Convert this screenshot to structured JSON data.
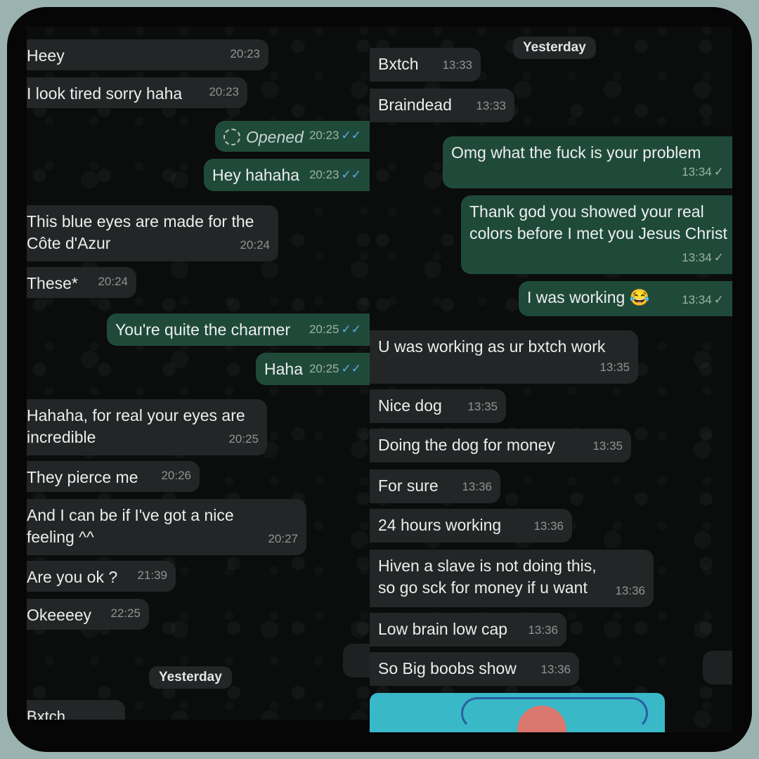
{
  "left": {
    "messages": [
      {
        "text": "Heey",
        "time": "20:23",
        "dir": "in"
      },
      {
        "text": "I look tired sorry haha",
        "time": "20:23",
        "dir": "in"
      },
      {
        "text": "Opened",
        "time": "20:23",
        "dir": "out",
        "status": "read"
      },
      {
        "text": "Hey hahaha",
        "time": "20:23",
        "dir": "out",
        "status": "read"
      },
      {
        "text": "This blue eyes are made for the Côte d'Azur",
        "time": "20:24",
        "dir": "in"
      },
      {
        "text": "These*",
        "time": "20:24",
        "dir": "in"
      },
      {
        "text": "You're quite the charmer",
        "time": "20:25",
        "dir": "out",
        "status": "read"
      },
      {
        "text": "Haha",
        "time": "20:25",
        "dir": "out",
        "status": "read"
      },
      {
        "text": "Hahaha, for real your eyes are incredible",
        "time": "20:25",
        "dir": "in"
      },
      {
        "text": "They pierce me",
        "time": "20:26",
        "dir": "in"
      },
      {
        "text": "And I can be if I've got a nice feeling ^^",
        "time": "20:27",
        "dir": "in"
      },
      {
        "text": "Are you ok ?",
        "time": "21:39",
        "dir": "in"
      },
      {
        "text": "Okeeeey",
        "time": "22:25",
        "dir": "in"
      }
    ],
    "date_separator": "Yesterday",
    "cut_off_message": "Bxtch"
  },
  "right": {
    "date_separator": "Yesterday",
    "messages": [
      {
        "text": "Bxtch",
        "time": "13:33",
        "dir": "in"
      },
      {
        "text": "Braindead",
        "time": "13:33",
        "dir": "in"
      },
      {
        "text": "Omg what the fuck is your problem",
        "time": "13:34",
        "dir": "out",
        "status": "sent"
      },
      {
        "text": "Thank god you showed your real colors before I met you Jesus Christ",
        "time": "13:34",
        "dir": "out",
        "status": "sent"
      },
      {
        "text": "I was working 😂",
        "time": "13:34",
        "dir": "out",
        "status": "sent"
      },
      {
        "text": "U was working as ur bxtch work",
        "time": "13:35",
        "dir": "in"
      },
      {
        "text": "Nice dog",
        "time": "13:35",
        "dir": "in"
      },
      {
        "text": "Doing the dog for money",
        "time": "13:35",
        "dir": "in"
      },
      {
        "text": "For sure",
        "time": "13:36",
        "dir": "in"
      },
      {
        "text": "24 hours working",
        "time": "13:36",
        "dir": "in"
      },
      {
        "text": "Hiven a slave is not doing this, so go sck for money if u want",
        "time": "13:36",
        "dir": "in"
      },
      {
        "text": "Low brain low cap",
        "time": "13:36",
        "dir": "in"
      },
      {
        "text": "So Big boobs show",
        "time": "13:36",
        "dir": "in"
      }
    ]
  },
  "colors": {
    "background": "#9bb3b0",
    "incoming_bubble": "#232626",
    "outgoing_bubble": "#1f4a3a",
    "read_check": "#5fa8f0"
  },
  "icons": {
    "read_receipt": "double-check-icon",
    "sent_receipt": "single-check-icon",
    "opened": "opened-view-once-icon"
  }
}
